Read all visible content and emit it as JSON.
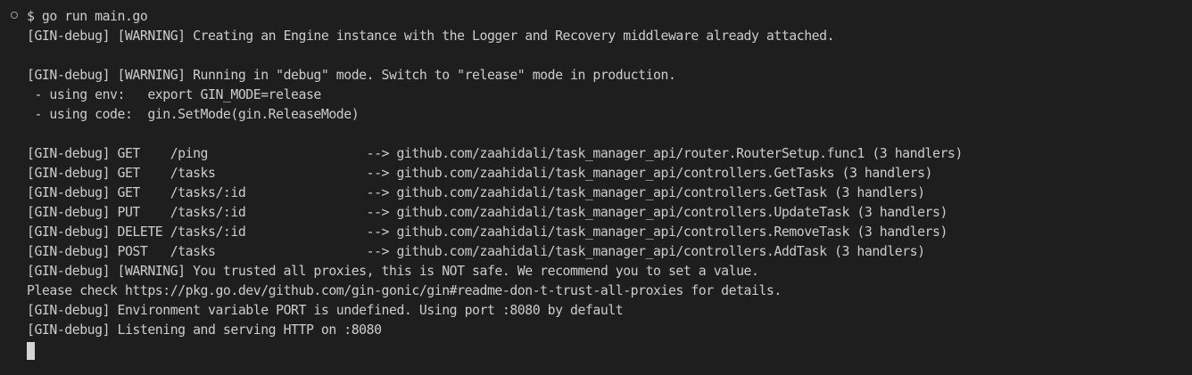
{
  "terminal": {
    "lines": [
      "$ go run main.go",
      "[GIN-debug] [WARNING] Creating an Engine instance with the Logger and Recovery middleware already attached.",
      "",
      "[GIN-debug] [WARNING] Running in \"debug\" mode. Switch to \"release\" mode in production.",
      " - using env:   export GIN_MODE=release",
      " - using code:  gin.SetMode(gin.ReleaseMode)",
      "",
      "[GIN-debug] GET    /ping                     --> github.com/zaahidali/task_manager_api/router.RouterSetup.func1 (3 handlers)",
      "[GIN-debug] GET    /tasks                    --> github.com/zaahidali/task_manager_api/controllers.GetTasks (3 handlers)",
      "[GIN-debug] GET    /tasks/:id                --> github.com/zaahidali/task_manager_api/controllers.GetTask (3 handlers)",
      "[GIN-debug] PUT    /tasks/:id                --> github.com/zaahidali/task_manager_api/controllers.UpdateTask (3 handlers)",
      "[GIN-debug] DELETE /tasks/:id                --> github.com/zaahidali/task_manager_api/controllers.RemoveTask (3 handlers)",
      "[GIN-debug] POST   /tasks                    --> github.com/zaahidali/task_manager_api/controllers.AddTask (3 handlers)",
      "[GIN-debug] [WARNING] You trusted all proxies, this is NOT safe. We recommend you to set a value.",
      "Please check https://pkg.go.dev/github.com/gin-gonic/gin#readme-don-t-trust-all-proxies for details.",
      "[GIN-debug] Environment variable PORT is undefined. Using port :8080 by default",
      "[GIN-debug] Listening and serving HTTP on :8080"
    ]
  },
  "colors": {
    "background": "#1e1e1e",
    "foreground": "#cccccc",
    "cursor": "#d4d4d4"
  }
}
